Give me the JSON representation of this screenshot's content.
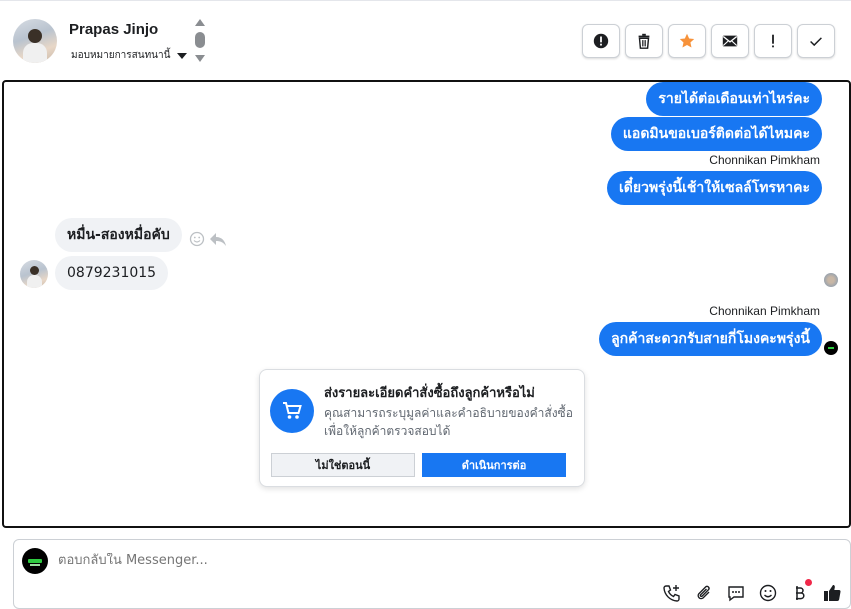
{
  "header": {
    "contact_name": "Prapas Jinjo",
    "assign_label": "มอบหมายการสนทนานี้"
  },
  "toolbar": {
    "buttons": [
      {
        "name": "spam",
        "icon": "alert-circle-icon"
      },
      {
        "name": "delete",
        "icon": "trash-icon"
      },
      {
        "name": "star",
        "icon": "star-icon"
      },
      {
        "name": "mark-unread",
        "icon": "envelope-icon"
      },
      {
        "name": "important",
        "icon": "exclamation-icon"
      },
      {
        "name": "done",
        "icon": "check-icon"
      }
    ],
    "star_color": "#f7923a"
  },
  "messages": {
    "out_1": "รายได้ต่อเดือนเท่าไหร่คะ",
    "out_2": "แอดมินขอเบอร์ติดต่อได้ไหมคะ",
    "sender_1": "Chonnikan Pimkham",
    "out_3": "เดี๋ยวพรุ่งนี้เช้าให้เซลล์โทรหาคะ",
    "in_1": "หมื่น-สองหมื่อคับ",
    "in_2": "0879231015",
    "sender_2": "Chonnikan Pimkham",
    "out_4": "ลูกค้าสะดวกรับสายกี่โมงคะพรุ่งนี้"
  },
  "order_card": {
    "title": "ส่งรายละเอียดคำสั่งซื้อถึงลูกค้าหรือไม่",
    "description": "คุณสามารถระบุมูลค่าและคำอธิบายของคำสั่งซื้อเพื่อให้ลูกค้าตรวจสอบได้",
    "secondary_button": "ไม่ใช่ตอนนี้",
    "primary_button": "ดำเนินการต่อ",
    "icon": "cart-icon"
  },
  "composer": {
    "placeholder": "ตอบกลับใน Messenger...",
    "icons": [
      "call-add-icon",
      "attach-icon",
      "saved-reply-icon",
      "emoji-icon",
      "baht-icon",
      "like-icon"
    ]
  },
  "colors": {
    "messenger_blue": "#1877f2",
    "bubble_in": "#f0f2f5",
    "notification_red": "#f02849"
  }
}
